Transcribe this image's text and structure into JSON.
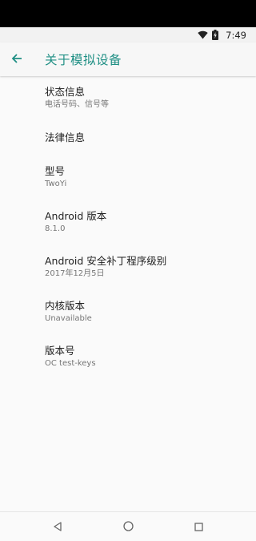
{
  "status_bar": {
    "time": "7:49",
    "icons": [
      "wifi-icon",
      "battery-charging-icon"
    ]
  },
  "app_bar": {
    "title": "关于模拟设备",
    "back_icon": "arrow-back-icon",
    "accent_color": "#1f8f84"
  },
  "items": [
    {
      "title": "状态信息",
      "summary": "电话号码、信号等"
    },
    {
      "title": "法律信息",
      "summary": ""
    },
    {
      "title": "型号",
      "summary": "TwoYi"
    },
    {
      "title": "Android 版本",
      "summary": "8.1.0"
    },
    {
      "title": "Android 安全补丁程序级别",
      "summary": "2017年12月5日"
    },
    {
      "title": "内核版本",
      "summary": "Unavailable"
    },
    {
      "title": "版本号",
      "summary": "OC test-keys"
    }
  ],
  "nav_bar": {
    "buttons": [
      "back-triangle-icon",
      "home-circle-icon",
      "recents-square-icon"
    ]
  }
}
